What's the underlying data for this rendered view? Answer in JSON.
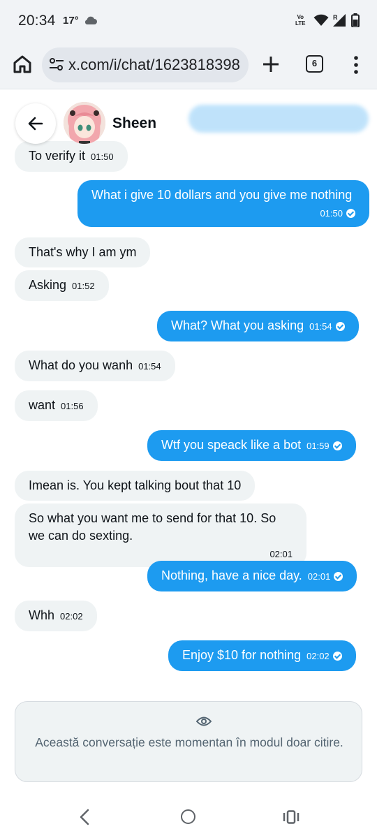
{
  "status_bar": {
    "time": "20:34",
    "temperature": "17°",
    "volte_line1": "Vo",
    "volte_line2": "LTE",
    "icons": [
      "cloud-icon",
      "wifi-icon",
      "signal-icon",
      "battery-icon"
    ]
  },
  "browser": {
    "url": "x.com/i/chat/1623818398",
    "tab_count": "6",
    "icons": [
      "home-icon",
      "site-settings-icon",
      "plus-icon",
      "menu-dots-icon"
    ]
  },
  "chat": {
    "contact_name": "Sheen",
    "accent_color": "#1d9bf0",
    "incoming_color": "#eff3f4",
    "messages": [
      {
        "dir": "in",
        "text": "To verify it",
        "time": "01:50"
      },
      {
        "dir": "out",
        "text": "What i give 10 dollars and you give me nothing",
        "time": "01:50"
      },
      {
        "dir": "in",
        "text": "That's why I am ym",
        "time": ""
      },
      {
        "dir": "in",
        "text": "Asking",
        "time": "01:52"
      },
      {
        "dir": "out",
        "text": "What? What you asking",
        "time": "01:54"
      },
      {
        "dir": "in",
        "text": "What do you wanh",
        "time": "01:54"
      },
      {
        "dir": "in",
        "text": "want",
        "time": "01:56"
      },
      {
        "dir": "out",
        "text": "Wtf you speack like a bot",
        "time": "01:59"
      },
      {
        "dir": "in",
        "text": "Imean is. You kept talking bout that 10",
        "time": ""
      },
      {
        "dir": "in",
        "text": "So what you want me to send for that 10. So we can do sexting.",
        "time": "02:01"
      },
      {
        "dir": "out",
        "text": "Nothing, have a nice day.",
        "time": "02:01"
      },
      {
        "dir": "in",
        "text": "Whh",
        "time": "02:02"
      },
      {
        "dir": "out",
        "text": "Enjoy $10 for nothing",
        "time": "02:02"
      }
    ]
  },
  "read_only_notice": {
    "text": "Această conversație este momentan în modul doar citire.",
    "icon": "eye-icon"
  },
  "nav_bar": {
    "icons": [
      "nav-back-icon",
      "nav-home-icon",
      "nav-recents-icon"
    ]
  }
}
